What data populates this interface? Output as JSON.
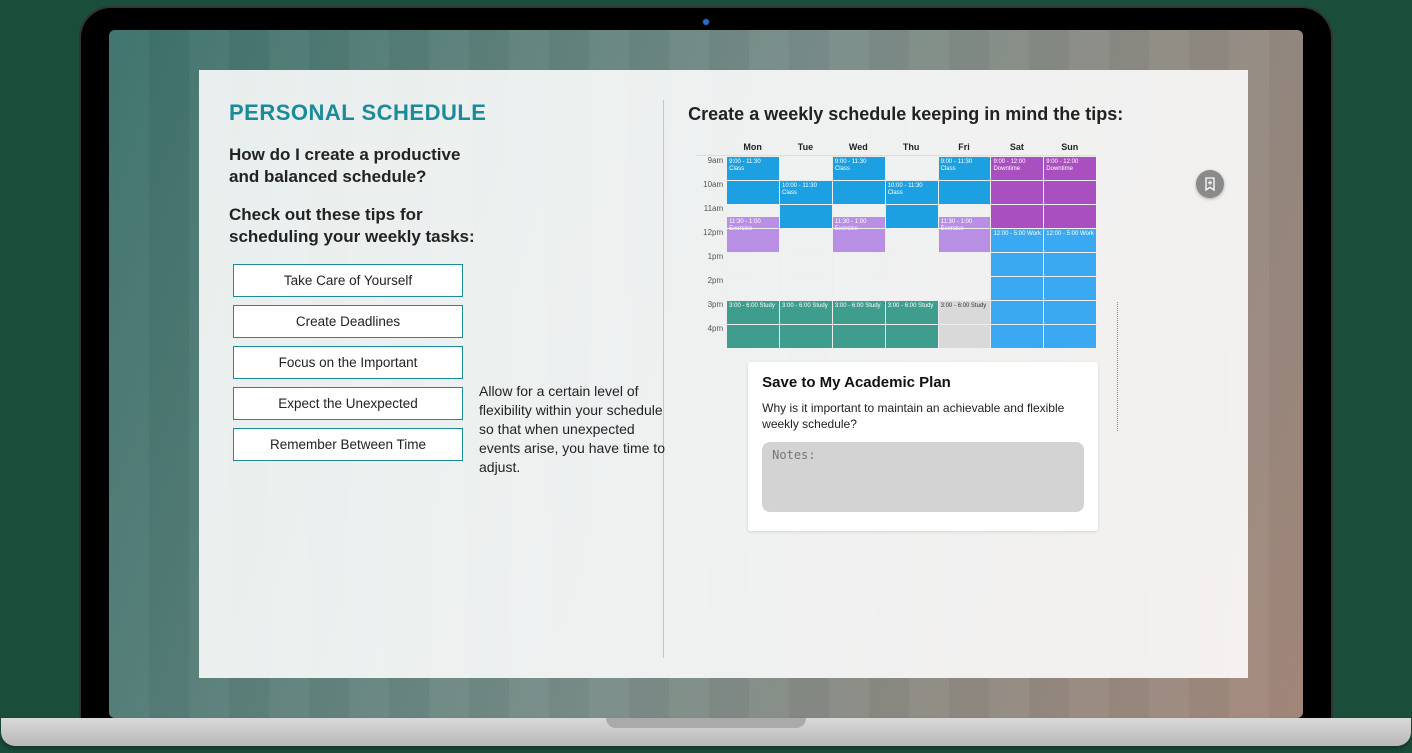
{
  "panel": {
    "title": "PERSONAL SCHEDULE",
    "q1": "How do I create a productive and balanced schedule?",
    "q2": "Check out these tips for scheduling your weekly tasks:",
    "tips": [
      "Take Care of Yourself",
      "Create Deadlines",
      "Focus on the Important",
      "Expect the Unexpected",
      "Remember Between Time"
    ],
    "tip_detail": "Allow for a certain level of flexibility within your schedule so that when unexpected events arise, you have time to adjust."
  },
  "right": {
    "title": "Create a weekly schedule keeping in mind the tips:",
    "days": [
      "Mon",
      "Tue",
      "Wed",
      "Thu",
      "Fri",
      "Sat",
      "Sun"
    ],
    "hours": [
      "9am",
      "10am",
      "11am",
      "12pm",
      "1pm",
      "2pm",
      "3pm",
      "4pm"
    ],
    "events": [
      {
        "day": 0,
        "start": 0,
        "span": 2,
        "label": "9:00 - 11:30\nClass",
        "cls": "ev-blue"
      },
      {
        "day": 2,
        "start": 0,
        "span": 2,
        "label": "9:00 - 11:30\nClass",
        "cls": "ev-blue"
      },
      {
        "day": 4,
        "start": 0,
        "span": 2,
        "label": "9:00 - 11:30\nClass",
        "cls": "ev-blue"
      },
      {
        "day": 1,
        "start": 1,
        "span": 2,
        "label": "10:00 - 11:30\nClass",
        "cls": "ev-blue"
      },
      {
        "day": 3,
        "start": 1,
        "span": 2,
        "label": "10:00 - 11:30\nClass",
        "cls": "ev-blue"
      },
      {
        "day": 5,
        "start": 0,
        "span": 3,
        "label": "9:00 - 12:00\nDowntime",
        "cls": "ev-purple"
      },
      {
        "day": 6,
        "start": 0,
        "span": 3,
        "label": "9:00 - 12:00\nDowntime",
        "cls": "ev-purple"
      },
      {
        "day": 0,
        "start": 2.5,
        "span": 1.5,
        "label": "11:30 - 1:00\nExercise",
        "cls": "ev-lilac"
      },
      {
        "day": 2,
        "start": 2.5,
        "span": 1.5,
        "label": "11:30 - 1:00\nExercise",
        "cls": "ev-lilac"
      },
      {
        "day": 4,
        "start": 2.5,
        "span": 1.5,
        "label": "11:30 - 1:00\nExercise",
        "cls": "ev-lilac"
      },
      {
        "day": 5,
        "start": 3,
        "span": 5,
        "label": "12:00 - 5:00\nWork",
        "cls": "ev-sky"
      },
      {
        "day": 6,
        "start": 3,
        "span": 5,
        "label": "12:00 - 5:00\nWork",
        "cls": "ev-sky"
      },
      {
        "day": 0,
        "start": 6,
        "span": 2,
        "label": "3:00 - 6:00\nStudy",
        "cls": "ev-teal"
      },
      {
        "day": 1,
        "start": 6,
        "span": 2,
        "label": "3:00 - 6:00\nStudy",
        "cls": "ev-teal"
      },
      {
        "day": 2,
        "start": 6,
        "span": 2,
        "label": "3:00 - 6:00\nStudy",
        "cls": "ev-teal"
      },
      {
        "day": 3,
        "start": 6,
        "span": 2,
        "label": "3:00 - 6:00\nStudy",
        "cls": "ev-teal"
      },
      {
        "day": 4,
        "start": 6,
        "span": 2,
        "label": "3:00 - 6:00\nStudy",
        "cls": "ev-gray"
      }
    ]
  },
  "save": {
    "title": "Save to My Academic Plan",
    "question": "Why is it important to maintain an achievable and flexible weekly schedule?",
    "notes_label": "Notes:",
    "notes_value": ""
  }
}
